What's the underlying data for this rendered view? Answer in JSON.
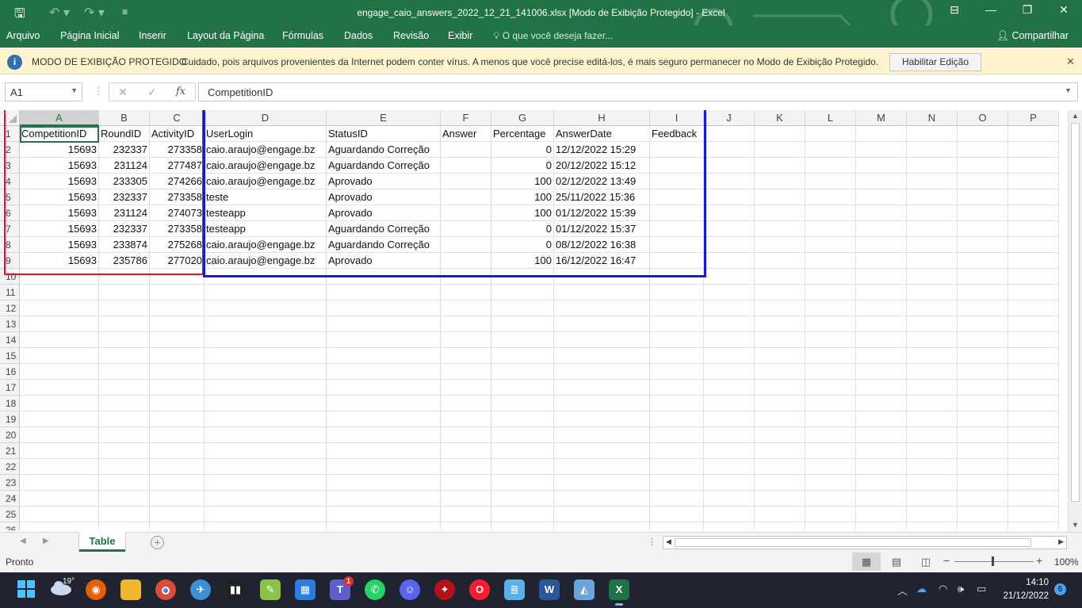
{
  "window": {
    "title": "engage_caio_answers_2022_12_21_141006.xlsx  [Modo de Exibição Protegido] - Excel",
    "controls": [
      "⊟",
      "—",
      "❐",
      "✕"
    ]
  },
  "ribbon": {
    "tabs": [
      "Arquivo",
      "Página Inicial",
      "Inserir",
      "Layout da Página",
      "Fórmulas",
      "Dados",
      "Revisão",
      "Exibir"
    ],
    "tell_me": "O que você deseja fazer...",
    "share": "Compartilhar"
  },
  "protected_view": {
    "heading": "MODO DE EXIBIÇÃO PROTEGIDO",
    "message": "Cuidado, pois arquivos provenientes da Internet podem conter vírus. A menos que você precise editá-los, é mais seguro permanecer no Modo de  Exibição Protegido.",
    "enable_button": "Habilitar Edição",
    "icon": "shield-icon"
  },
  "formula_bar": {
    "name_box": "A1",
    "formula": "CompetitionID",
    "fx": "fx"
  },
  "sheet": {
    "columns": [
      "A",
      "B",
      "C",
      "D",
      "E",
      "F",
      "G",
      "H",
      "I",
      "J",
      "K",
      "L",
      "M",
      "N",
      "O",
      "P"
    ],
    "row_numbers": [
      "1",
      "2",
      "3",
      "4",
      "5",
      "6",
      "7",
      "8",
      "9",
      "10",
      "11",
      "12",
      "13",
      "14",
      "15",
      "16",
      "17",
      "18",
      "19",
      "20",
      "21",
      "22",
      "23",
      "24",
      "25",
      "26"
    ],
    "headers": [
      "CompetitionID",
      "RoundID",
      "ActivityID",
      "UserLogin",
      "StatusID",
      "Answer",
      "Percentage",
      "AnswerDate",
      "Feedback"
    ],
    "rows": [
      [
        "15693",
        "232337",
        "273358",
        "caio.araujo@engage.bz",
        "Aguardando Correção",
        "",
        "0",
        "12/12/2022 15:29",
        ""
      ],
      [
        "15693",
        "231124",
        "277487",
        "caio.araujo@engage.bz",
        "Aguardando Correção",
        "",
        "0",
        "20/12/2022 15:12",
        ""
      ],
      [
        "15693",
        "233305",
        "274266",
        "caio.araujo@engage.bz",
        "Aprovado",
        "",
        "100",
        "02/12/2022 13:49",
        ""
      ],
      [
        "15693",
        "232337",
        "273358",
        "teste",
        "Aprovado",
        "",
        "100",
        "25/11/2022 15:36",
        ""
      ],
      [
        "15693",
        "231124",
        "274073",
        "testeapp",
        "Aprovado",
        "",
        "100",
        "01/12/2022 15:39",
        ""
      ],
      [
        "15693",
        "232337",
        "273358",
        "testeapp",
        "Aguardando Correção",
        "",
        "0",
        "01/12/2022 15:37",
        ""
      ],
      [
        "15693",
        "233874",
        "275268",
        "caio.araujo@engage.bz",
        "Aguardando Correção",
        "",
        "0",
        "08/12/2022 16:38",
        ""
      ],
      [
        "15693",
        "235786",
        "277020",
        "caio.araujo@engage.bz",
        "Aprovado",
        "",
        "100",
        "16/12/2022 16:47",
        ""
      ]
    ],
    "highlight_colors": {
      "red_box": "#e81224",
      "blue_box": "#1a19d8"
    }
  },
  "sheet_tabs": {
    "active": "Table",
    "add": "+"
  },
  "status": {
    "text": "Pronto",
    "zoom": "100%"
  },
  "taskbar": {
    "weather_temp": "19°",
    "apps": [
      "windows-start",
      "firefox",
      "file-explorer",
      "chrome",
      "maps",
      "audio-app",
      "notepad-app",
      "calendar",
      "teams",
      "whatsapp",
      "discord",
      "game-app",
      "opera",
      "notepad",
      "word",
      "photos",
      "excel"
    ],
    "teams_badge": "1",
    "time": "14:10",
    "date": "21/12/2022",
    "notifications": "6"
  },
  "colors": {
    "excel_green": "#217346",
    "taskbar": "#1f2430",
    "warning_bar": "#fff4ce"
  }
}
